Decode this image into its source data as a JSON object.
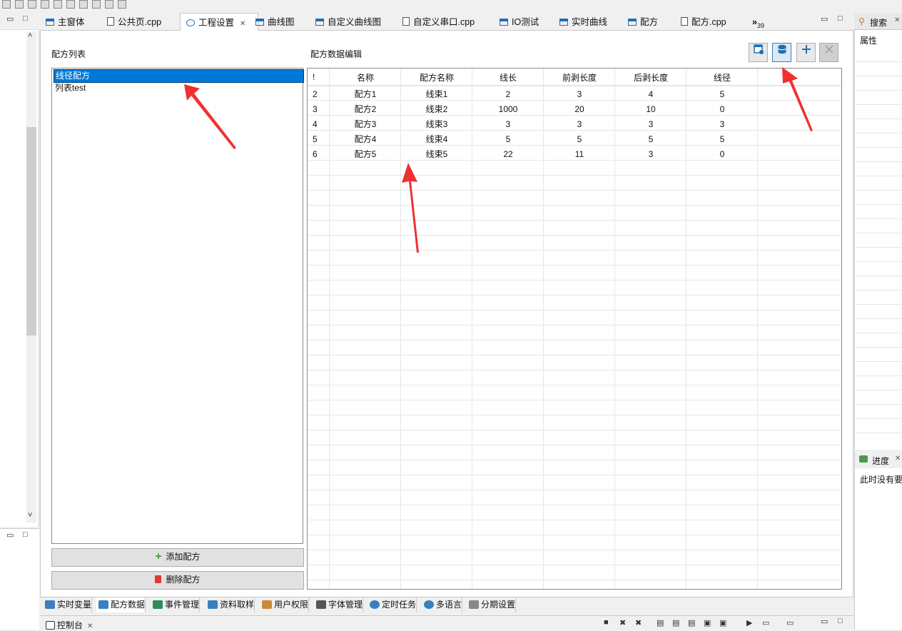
{
  "editor_tabs": [
    {
      "label": "主窗体",
      "icon": "form-icon"
    },
    {
      "label": "公共页.cpp",
      "icon": "cpp-file-icon"
    },
    {
      "label": "工程设置",
      "icon": "gear-icon"
    },
    {
      "label": "曲线图",
      "icon": "form-icon"
    },
    {
      "label": "自定义曲线图",
      "icon": "form-icon"
    },
    {
      "label": "自定义串口.cpp",
      "icon": "cpp-file-icon"
    },
    {
      "label": "IO测试",
      "icon": "form-icon"
    },
    {
      "label": "实时曲线",
      "icon": "form-icon"
    },
    {
      "label": "配方",
      "icon": "form-icon"
    },
    {
      "label": "配方.cpp",
      "icon": "cpp-file-icon"
    }
  ],
  "overflow_tabs": {
    "chevron": "»",
    "count": "39"
  },
  "tab_close_glyph": "✕",
  "recipe_list": {
    "title": "配方列表",
    "items": [
      {
        "label": "线径配方",
        "selected": true
      },
      {
        "label": "列表test",
        "selected": false
      }
    ],
    "add_button": "添加配方",
    "delete_button": "删除配方"
  },
  "recipe_editor": {
    "title": "配方数据编辑",
    "columns": [
      "!",
      "名称",
      "配方名称",
      "线长",
      "前剥长度",
      "后剥长度",
      "线径"
    ],
    "rows": [
      [
        "2",
        "配方1",
        "线束1",
        "2",
        "3",
        "4",
        "5"
      ],
      [
        "3",
        "配方2",
        "线束2",
        "1000",
        "20",
        "10",
        "0"
      ],
      [
        "4",
        "配方3",
        "线束3",
        "3",
        "3",
        "3",
        "3"
      ],
      [
        "5",
        "配方4",
        "线束4",
        "5",
        "5",
        "5",
        "5"
      ],
      [
        "6",
        "配方5",
        "线束5",
        "22",
        "11",
        "3",
        "0"
      ]
    ],
    "toolbar_icons": [
      "table-settings-icon",
      "database-icon",
      "add-icon",
      "close-icon"
    ]
  },
  "bottom_tabs": [
    {
      "label": "实时变量"
    },
    {
      "label": "配方数据"
    },
    {
      "label": "事件管理"
    },
    {
      "label": "资料取样"
    },
    {
      "label": "用户权限"
    },
    {
      "label": "字体管理"
    },
    {
      "label": "定时任务"
    },
    {
      "label": "多语言"
    },
    {
      "label": "分期设置"
    }
  ],
  "console": {
    "label": "控制台"
  },
  "right_panel": {
    "search_tab": "搜索",
    "properties_label": "属性",
    "progress_tab": "进度",
    "progress_text": "此时没有要"
  },
  "colors": {
    "selection": "#0078d7",
    "arrow": "#f03030",
    "accent": "#1f6fb5"
  }
}
